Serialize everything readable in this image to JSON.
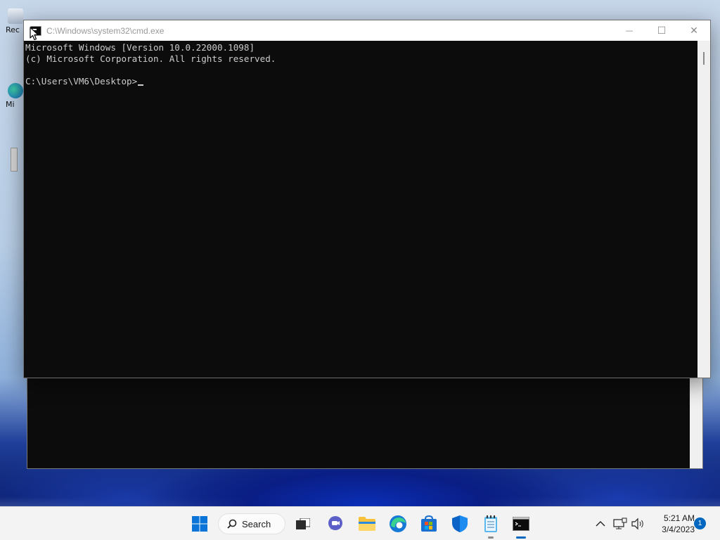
{
  "desktop": {
    "icons": [
      {
        "label": "Rec",
        "name": "recycle-bin"
      },
      {
        "label": "Mi",
        "name": "microsoft-edge-shortcut"
      }
    ]
  },
  "window": {
    "title": "C:\\Windows\\system32\\cmd.exe",
    "console_lines": [
      "Microsoft Windows [Version 10.0.22000.1098]",
      "(c) Microsoft Corporation. All rights reserved.",
      "",
      "C:\\Users\\VM6\\Desktop>"
    ],
    "controls": {
      "minimize": "—",
      "maximize": "☐",
      "close": "✕"
    }
  },
  "taskbar": {
    "search_label": "Search",
    "apps": [
      {
        "name": "start",
        "icon": "windows-logo-icon"
      },
      {
        "name": "search",
        "icon": "search-icon"
      },
      {
        "name": "task-view",
        "icon": "task-view-icon"
      },
      {
        "name": "chat",
        "icon": "teams-chat-icon"
      },
      {
        "name": "file-explorer",
        "icon": "folder-icon"
      },
      {
        "name": "edge",
        "icon": "edge-icon"
      },
      {
        "name": "store",
        "icon": "store-icon"
      },
      {
        "name": "defender",
        "icon": "shield-icon"
      },
      {
        "name": "notepad",
        "icon": "notepad-icon"
      },
      {
        "name": "command-prompt",
        "icon": "cmd-icon"
      }
    ],
    "time": "5:21 AM",
    "date": "3/4/2023",
    "notification_count": "1"
  },
  "colors": {
    "console_bg": "#0c0c0c",
    "console_fg": "#cccccc",
    "accent": "#0067c0",
    "taskbar_bg": "#f3f3f3"
  }
}
